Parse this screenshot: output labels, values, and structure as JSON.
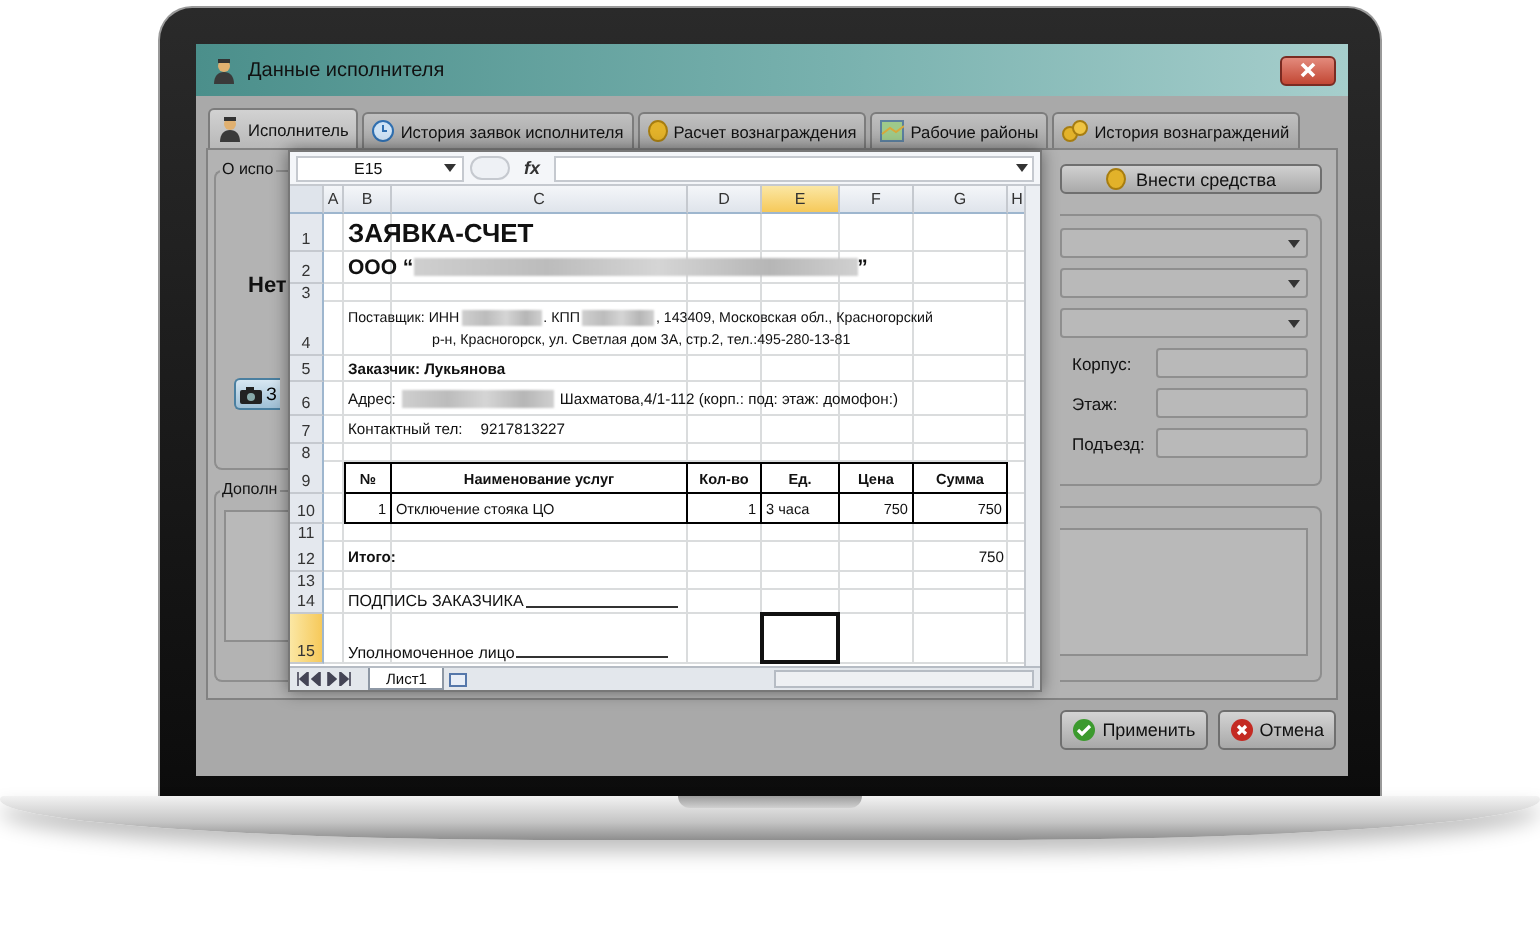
{
  "window": {
    "title": "Данные исполнителя"
  },
  "tabs": [
    {
      "label": "Исполнитель",
      "selected": true,
      "kind": "user"
    },
    {
      "label": "История заявок исполнителя",
      "selected": false,
      "kind": "clock"
    },
    {
      "label": "Расчет вознаграждения",
      "selected": false,
      "kind": "coin"
    },
    {
      "label": "Рабочие районы",
      "selected": false,
      "kind": "map"
    },
    {
      "label": "История вознаграждений",
      "selected": false,
      "kind": "coins"
    }
  ],
  "left_panel": {
    "group_label": "О испо",
    "status_text": "Нет",
    "camera_button": "З",
    "extra_group_label": "Дополн"
  },
  "deposit_button": "Внести средства",
  "address_fields": [
    {
      "label": "Корпус:"
    },
    {
      "label": "Этаж:"
    },
    {
      "label": "Подъезд:"
    }
  ],
  "buttons": [
    {
      "label": "Применить",
      "kind": "apply"
    },
    {
      "label": "Отмена",
      "kind": "cancel"
    }
  ],
  "spreadsheet": {
    "name_box": "E15",
    "formula_label": "fx",
    "columns": [
      {
        "label": "A",
        "selected": false
      },
      {
        "label": "B",
        "selected": false
      },
      {
        "label": "C",
        "selected": false
      },
      {
        "label": "D",
        "selected": false
      },
      {
        "label": "E",
        "selected": true
      },
      {
        "label": "F",
        "selected": false
      },
      {
        "label": "G",
        "selected": false
      },
      {
        "label": "H",
        "selected": false
      }
    ],
    "rows": [
      {
        "number": "1",
        "selected": false,
        "kind": "title",
        "text": "ЗАЯВКА-СЧЕТ"
      },
      {
        "number": "2",
        "selected": false,
        "kind": "org",
        "prefix": "ООО “",
        "suffix": "”"
      },
      {
        "number": "3",
        "selected": false,
        "kind": "blank"
      },
      {
        "number": "4",
        "selected": false,
        "kind": "supplier",
        "parts": [
          "Поставщик: ИНН",
          ". КПП",
          ", 143409, Московская обл., Красногорский"
        ],
        "second_line": "р-н, Красногорск, ул. Светлая дом 3А, стр.2, тел.:495-280-13-81"
      },
      {
        "number": "5",
        "selected": false,
        "kind": "customer",
        "text": "Заказчик: Лукьянова"
      },
      {
        "number": "6",
        "selected": false,
        "kind": "address",
        "label": "Адрес:",
        "street": "Шахматова,4/1-112 (корп.: под: этаж: домофон:)"
      },
      {
        "number": "7",
        "selected": false,
        "kind": "phone",
        "label": "Контактный тел:",
        "phone_number": "9217813227"
      },
      {
        "number": "8",
        "selected": false,
        "kind": "blank"
      },
      {
        "number": "9",
        "selected": false,
        "kind": "table_header",
        "cells": [
          "№",
          "Наименование услуг",
          "Кол-во",
          "Ед.",
          "Цена",
          "Сумма"
        ]
      },
      {
        "number": "10",
        "selected": false,
        "kind": "table_row",
        "cells": [
          "1",
          "Отключение стояка ЦО",
          "1",
          "3 часа",
          "750",
          "750"
        ]
      },
      {
        "number": "11",
        "selected": false,
        "kind": "blank"
      },
      {
        "number": "12",
        "selected": false,
        "kind": "total",
        "label": "Итого:",
        "amount": "750"
      },
      {
        "number": "13",
        "selected": false,
        "kind": "blank"
      },
      {
        "number": "14",
        "selected": false,
        "kind": "signature",
        "text": "ПОДПИСЬ ЗАКАЗЧИКА"
      },
      {
        "number": "15",
        "selected": true,
        "kind": "authorized",
        "text": "Уполномоченное лицо"
      }
    ],
    "sheet_tabs": [
      {
        "label": "Лист1",
        "selected": true
      }
    ]
  }
}
